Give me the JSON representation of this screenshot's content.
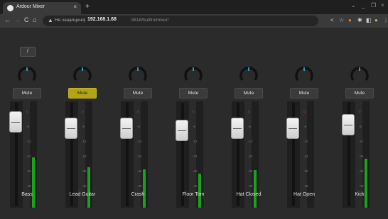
{
  "browser": {
    "tab_title": "Ardour Mixer",
    "tab_close": "×",
    "new_tab": "+",
    "win_min": "⌄",
    "win_restore": "_",
    "win_max": "❐",
    "win_close": "×",
    "nav_back": "←",
    "nav_forward": "→",
    "reload": "C",
    "home": "⌂",
    "warn_glyph": "▲",
    "security_label": "Не защищено",
    "separator": "|",
    "url_host": "192.168.1.68",
    "url_path": ":3818/builtin/mixer/"
  },
  "mixer": {
    "param_value": "/",
    "ticks": [
      "0",
      "-6",
      "-12",
      "-24",
      "-36",
      "-48"
    ],
    "strips": [
      {
        "name": "Bass",
        "mute_label": "Mute",
        "mute_active": false,
        "fader_pos": 0.88,
        "meter_level": 0.47
      },
      {
        "name": "Lead Guitar",
        "mute_label": "Mute",
        "mute_active": true,
        "fader_pos": 0.81,
        "meter_level": 0.38
      },
      {
        "name": "Crash",
        "mute_label": "Mute",
        "mute_active": false,
        "fader_pos": 0.81,
        "meter_level": 0.36
      },
      {
        "name": "Floor Tom",
        "mute_label": "Mute",
        "mute_active": false,
        "fader_pos": 0.78,
        "meter_level": 0.32
      },
      {
        "name": "Hat Closed",
        "mute_label": "Mute",
        "mute_active": false,
        "fader_pos": 0.81,
        "meter_level": 0.35
      },
      {
        "name": "Hat Open",
        "mute_label": "Mute",
        "mute_active": false,
        "fader_pos": 0.81,
        "meter_level": 0.0
      },
      {
        "name": "Kick",
        "mute_label": "Mute",
        "mute_active": false,
        "fader_pos": 0.85,
        "meter_level": 0.46
      }
    ]
  }
}
